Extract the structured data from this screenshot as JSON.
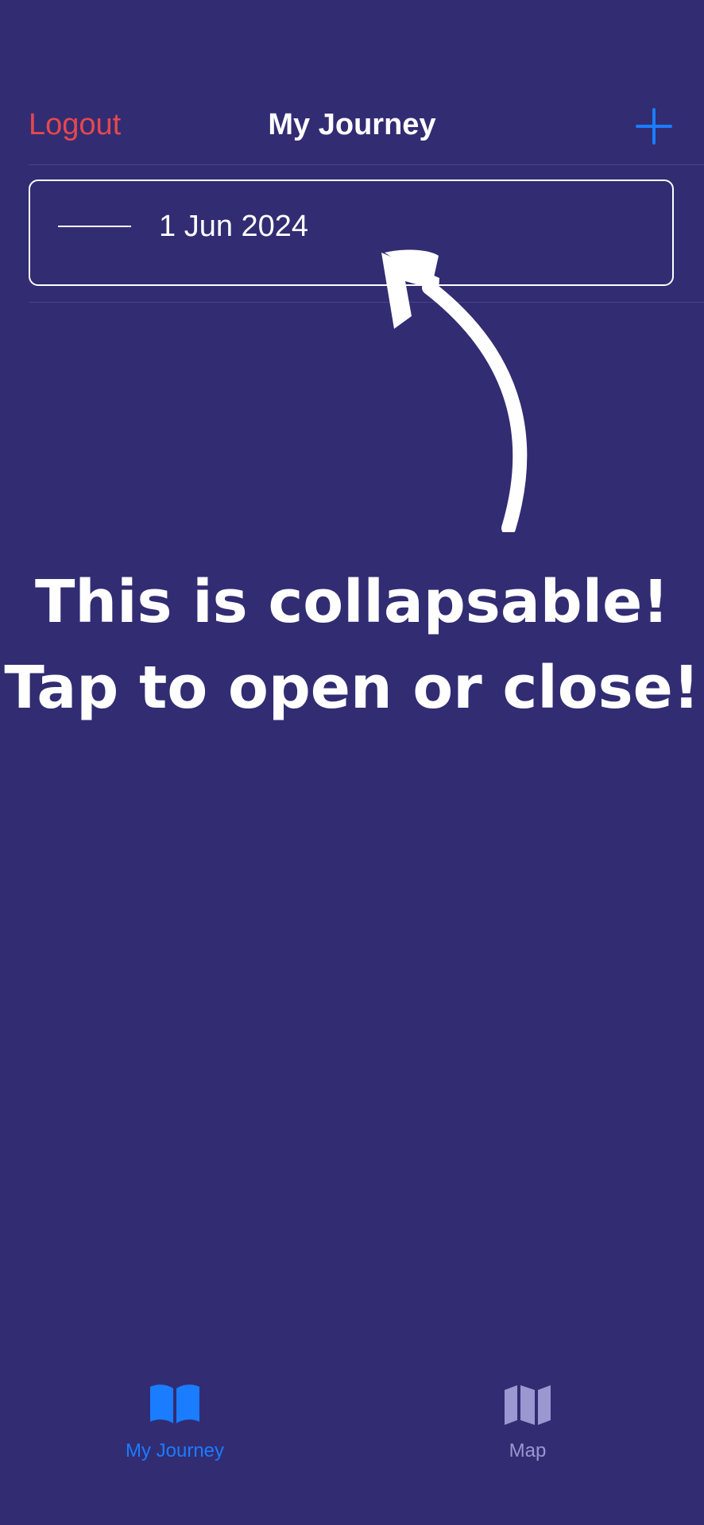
{
  "nav": {
    "logout_label": "Logout",
    "title": "My Journey",
    "add_icon": "plus-icon"
  },
  "entries": [
    {
      "date": "1 Jun 2024",
      "state_icon": "collapse-dash-icon"
    }
  ],
  "callout": {
    "line1": "This is collapsable!",
    "line2": "Tap to open or close!",
    "arrow_icon": "curved-arrow-icon"
  },
  "tabs": [
    {
      "label": "My Journey",
      "icon": "open-book-icon",
      "active": true
    },
    {
      "label": "Map",
      "icon": "map-icon",
      "active": false
    }
  ],
  "colors": {
    "background": "#322c73",
    "logout": "#e5484d",
    "accent": "#1a7cff",
    "inactive_tab": "#9b97d0",
    "text": "#ffffff"
  }
}
